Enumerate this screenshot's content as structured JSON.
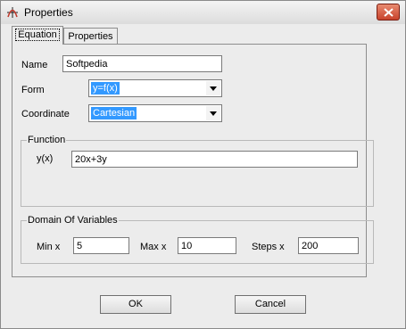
{
  "window": {
    "title": "Properties"
  },
  "tabs": [
    {
      "label": "Equation"
    },
    {
      "label": "Properties"
    }
  ],
  "form": {
    "name_label": "Name",
    "name_value": "Softpedia",
    "form_label": "Form",
    "form_selected": "y=f(x)",
    "coordinate_label": "Coordinate",
    "coordinate_selected": "Cartesian"
  },
  "function_group": {
    "title": "Function",
    "y_label": "y(x)",
    "y_value": "20x+3y"
  },
  "domain_group": {
    "title": "Domain Of Variables",
    "min_label": "Min x",
    "min_value": "5",
    "max_label": "Max x",
    "max_value": "10",
    "steps_label": "Steps x",
    "steps_value": "200"
  },
  "buttons": {
    "ok": "OK",
    "cancel": "Cancel"
  }
}
